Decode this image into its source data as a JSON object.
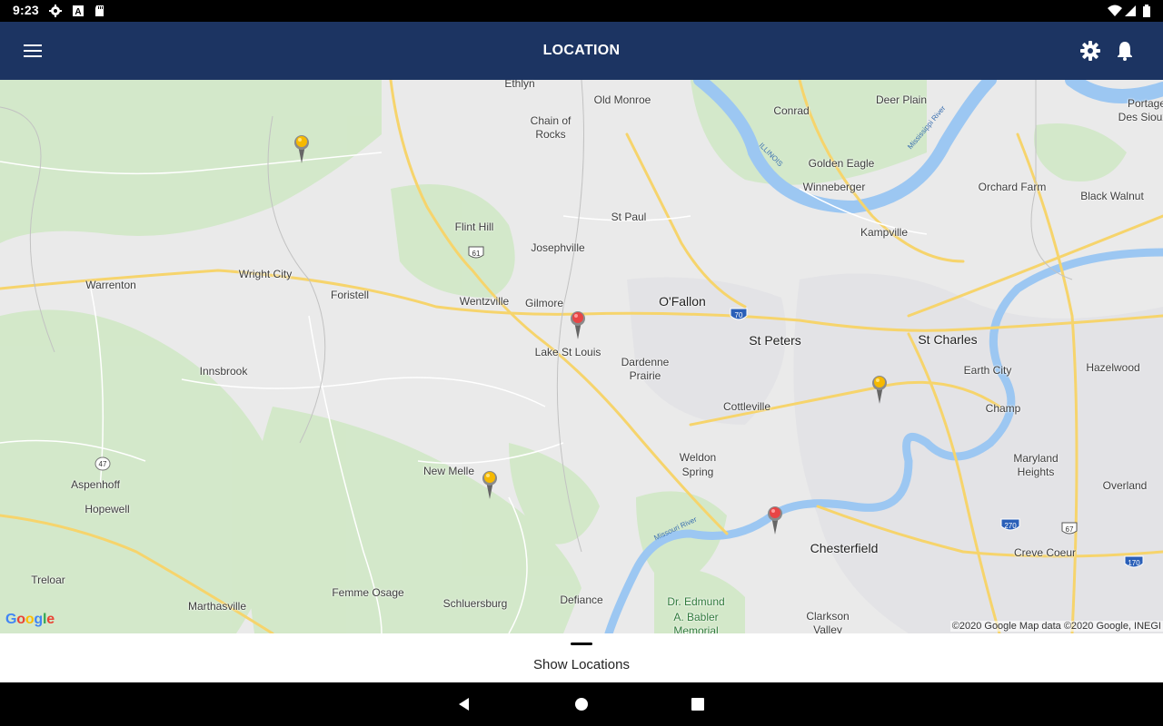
{
  "status_bar": {
    "time": "9:23",
    "left_icons": [
      "gear-icon",
      "a-icon",
      "sd-card-icon"
    ],
    "right_icons": [
      "wifi-icon",
      "signal-icon",
      "battery-icon"
    ]
  },
  "app_bar": {
    "title": "LOCATION",
    "background": "#1c3462",
    "left_icon": "menu-icon",
    "right_icons": [
      "settings-icon",
      "notifications-icon"
    ]
  },
  "map": {
    "places": [
      {
        "name": "Ethlyn",
        "size": "small"
      },
      {
        "name": "Old Monroe",
        "size": "small"
      },
      {
        "name": "Conrad",
        "size": "small"
      },
      {
        "name": "Deer Plain",
        "size": "small"
      },
      {
        "name": "Portage",
        "size": "small"
      },
      {
        "name": "Des Sioux",
        "size": "small"
      },
      {
        "name": "Chain of",
        "size": "small"
      },
      {
        "name": "Rocks",
        "size": "small"
      },
      {
        "name": "Golden Eagle",
        "size": "small"
      },
      {
        "name": "Winneberger",
        "size": "small"
      },
      {
        "name": "Orchard Farm",
        "size": "small"
      },
      {
        "name": "Black Walnut",
        "size": "small"
      },
      {
        "name": "St Paul",
        "size": "small"
      },
      {
        "name": "Flint Hill",
        "size": "small"
      },
      {
        "name": "Kampville",
        "size": "small"
      },
      {
        "name": "Josephville",
        "size": "small"
      },
      {
        "name": "Wright City",
        "size": "small"
      },
      {
        "name": "Warrenton",
        "size": "small"
      },
      {
        "name": "Foristell",
        "size": "small"
      },
      {
        "name": "Wentzville",
        "size": "small"
      },
      {
        "name": "Gilmore",
        "size": "small"
      },
      {
        "name": "O'Fallon",
        "size": "big"
      },
      {
        "name": "St Peters",
        "size": "big"
      },
      {
        "name": "St Charles",
        "size": "big"
      },
      {
        "name": "Lake St Louis",
        "size": "small"
      },
      {
        "name": "Dardenne",
        "size": "small"
      },
      {
        "name": "Prairie",
        "size": "small"
      },
      {
        "name": "Earth City",
        "size": "small"
      },
      {
        "name": "Hazelwood",
        "size": "small"
      },
      {
        "name": "Innsbrook",
        "size": "small"
      },
      {
        "name": "Cottleville",
        "size": "small"
      },
      {
        "name": "Champ",
        "size": "small"
      },
      {
        "name": "Weldon",
        "size": "small"
      },
      {
        "name": "Spring",
        "size": "small"
      },
      {
        "name": "Maryland",
        "size": "small"
      },
      {
        "name": "Heights",
        "size": "small"
      },
      {
        "name": "Aspenhoff",
        "size": "small"
      },
      {
        "name": "New Melle",
        "size": "small"
      },
      {
        "name": "Overland",
        "size": "small"
      },
      {
        "name": "Hopewell",
        "size": "small"
      },
      {
        "name": "Chesterfield",
        "size": "big"
      },
      {
        "name": "Creve Coeur",
        "size": "small"
      },
      {
        "name": "Treloar",
        "size": "small"
      },
      {
        "name": "Femme Osage",
        "size": "small"
      },
      {
        "name": "Defiance",
        "size": "small"
      },
      {
        "name": "Dr. Edmund",
        "size": "small"
      },
      {
        "name": "A. Babler",
        "size": "small"
      },
      {
        "name": "Memorial",
        "size": "small"
      },
      {
        "name": "Marthasville",
        "size": "small"
      },
      {
        "name": "Schluersburg",
        "size": "small"
      },
      {
        "name": "Clarkson",
        "size": "small"
      },
      {
        "name": "Valley",
        "size": "small"
      }
    ],
    "route_shields": [
      "61",
      "70",
      "47",
      "270",
      "67",
      "170"
    ],
    "river_labels": [
      "ILLINOIS",
      "Mississippi River",
      "Missouri River"
    ],
    "markers": [
      {
        "color": "yellow",
        "icon": "map-pin-yellow-icon"
      },
      {
        "color": "red",
        "icon": "map-pin-red-icon"
      },
      {
        "color": "yellow",
        "icon": "map-pin-yellow-icon"
      },
      {
        "color": "yellow",
        "icon": "map-pin-yellow-icon"
      },
      {
        "color": "red",
        "icon": "map-pin-red-icon"
      }
    ],
    "google_logo": "Google",
    "copyright": "©2020 Google  Map data ©2020 Google, INEGI"
  },
  "bottom_sheet": {
    "label": "Show Locations"
  },
  "nav_bar": {
    "buttons": [
      "back-icon",
      "home-icon",
      "recents-icon"
    ]
  }
}
